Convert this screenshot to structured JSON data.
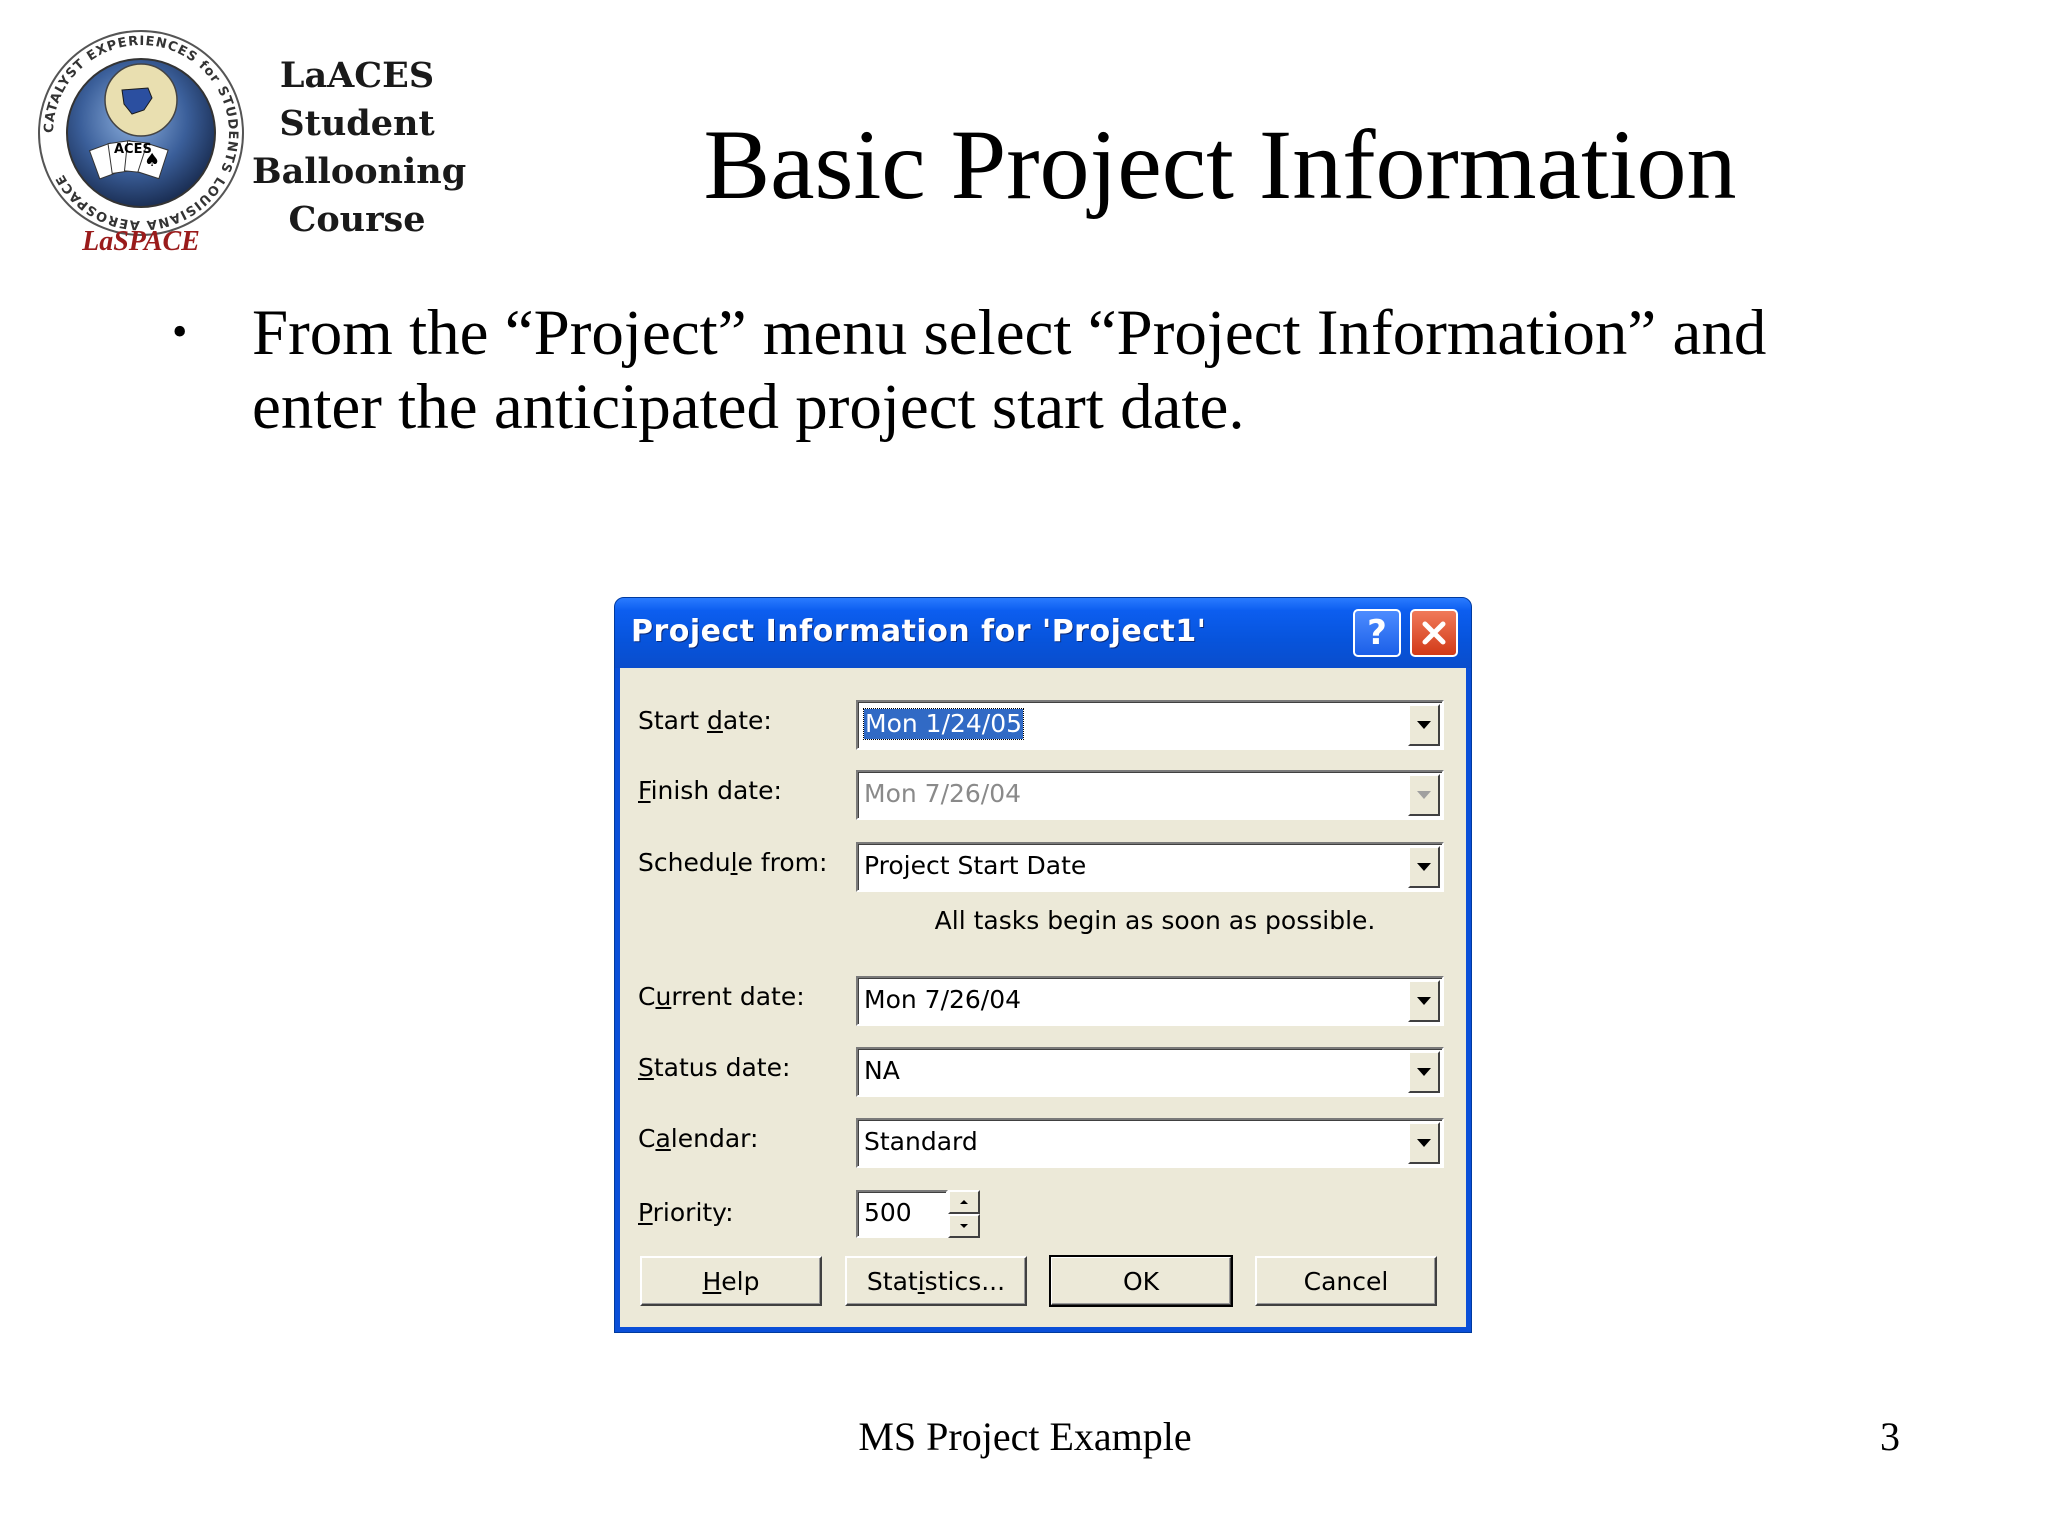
{
  "logo": {
    "ring_text": "CATALYST EXPERIENCES for STUDENTS LOUISIANA AEROSPACE",
    "inner_text": "ACES",
    "wordmark": "LaSPACE"
  },
  "course": [
    "LaACES",
    "Student",
    "Ballooning",
    "Course"
  ],
  "slide": {
    "title": "Basic Project Information",
    "bullet_char": "•",
    "bullet": "From the “Project” menu select “Project Information” and enter the anticipated project start date.",
    "footer": "MS Project Example",
    "page_number": "3"
  },
  "dialog": {
    "title": "Project Information for 'Project1'",
    "help_glyph": "?",
    "rows": [
      {
        "label_pre": "Start ",
        "label_key": "d",
        "label_post": "ate:",
        "value": "Mon 1/24/05"
      },
      {
        "label_pre": "",
        "label_key": "F",
        "label_post": "inish date:",
        "value": "Mon 7/26/04"
      },
      {
        "label_pre": "Schedu",
        "label_key": "l",
        "label_post": "e from:",
        "value": "Project Start Date"
      },
      {
        "label_pre": "C",
        "label_key": "u",
        "label_post": "rrent date:",
        "value": "Mon 7/26/04"
      },
      {
        "label_pre": "",
        "label_key": "S",
        "label_post": "tatus date:",
        "value": "NA"
      },
      {
        "label_pre": "C",
        "label_key": "a",
        "label_post": "lendar:",
        "value": "Standard"
      },
      {
        "label_pre": "",
        "label_key": "P",
        "label_post": "riority:",
        "value": "500"
      }
    ],
    "info": "All tasks begin as soon as possible.",
    "buttons": [
      {
        "pre": "",
        "key": "H",
        "post": "elp"
      },
      {
        "pre": "Stat",
        "key": "i",
        "post": "stics..."
      },
      {
        "pre": "OK",
        "key": "",
        "post": ""
      },
      {
        "pre": "Cancel",
        "key": "",
        "post": ""
      }
    ]
  }
}
